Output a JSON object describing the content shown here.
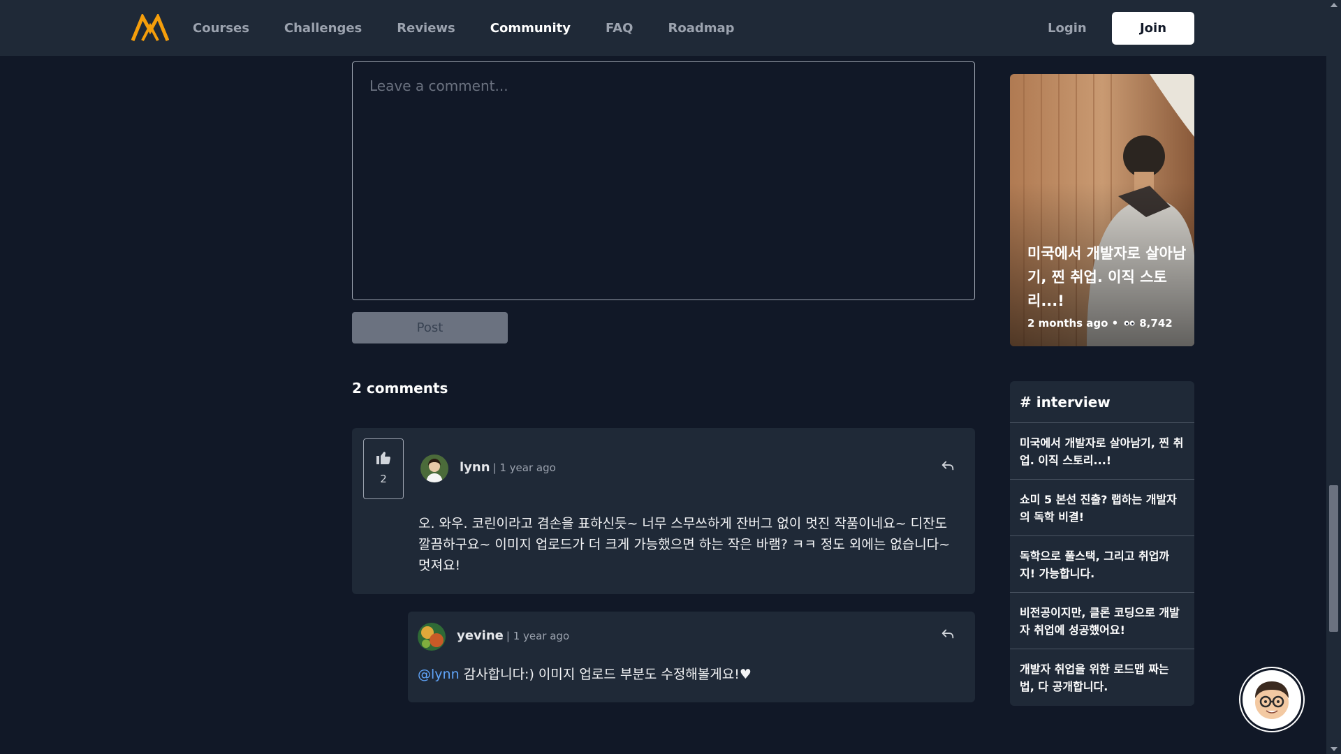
{
  "nav": {
    "links": [
      "Courses",
      "Challenges",
      "Reviews",
      "Community",
      "FAQ",
      "Roadmap"
    ],
    "active": "Community",
    "login": "Login",
    "join": "Join",
    "logo_color": "#f59e0b"
  },
  "editor": {
    "placeholder": "Leave a comment...",
    "post_label": "Post"
  },
  "comments": {
    "count_label": "2 comments",
    "first": {
      "likes": "2",
      "author": "lynn",
      "time": "| 1 year ago",
      "body": "오. 와우. 코린이라고 겸손을 표하신듯~ 너무 스무쓰하게 잔버그 없이 멋진 작품이네요~ 디잔도 깔끔하구요~ 이미지 업로드가 더 크게 가능했으면 하는 작은 바램? ㅋㅋ 정도 외에는 없습니다~ 멋져요!"
    },
    "reply": {
      "author": "yevine",
      "time": "| 1 year ago",
      "mention": "@lynn",
      "body": " 감사합니다:) 이미지 업로드 부분도 수정해볼게요!♥"
    }
  },
  "sidebar": {
    "feature": {
      "title": "미국에서 개발자로 살아남기, 찐 취업. 이직 스토리...!",
      "time": "2 months ago •",
      "views": "8,742"
    },
    "tag": {
      "header": "# interview",
      "items": [
        "미국에서 개발자로 살아남기, 찐 취업. 이직 스토리...!",
        "쇼미 5 본선 진출? 랩하는 개발자의 독학 비결!",
        "독학으로 풀스택, 그리고 취업까지! 가능합니다.",
        "비전공이지만, 클론 코딩으로 개발자 취업에 성공했어요!",
        "개발자 취업을 위한 로드맵 짜는 법, 다 공개합니다."
      ]
    }
  },
  "icons": {
    "logo": "logo-icon",
    "like": "thumbs-up-icon",
    "reply": "reply-icon",
    "views": "eye-icon",
    "chat": "chat-avatar-icon"
  }
}
